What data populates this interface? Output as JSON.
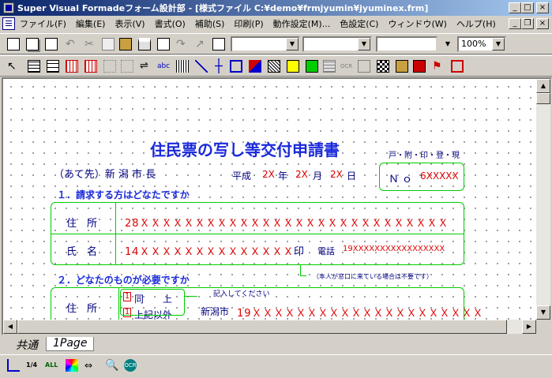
{
  "window": {
    "title": "Super Visual Formadeフォーム設計部 - [様式ファイル C:¥demo¥frmjyumin¥jyuminex.frm]",
    "minimize": "_",
    "maximize": "□",
    "close": "×"
  },
  "menu": {
    "items": [
      "ファイル(F)",
      "編集(E)",
      "表示(V)",
      "書式(O)",
      "補助(S)",
      "印刷(P)",
      "動作設定(M)...",
      "色設定(C)",
      "ウィンドウ(W)",
      "ヘルプ(H)"
    ]
  },
  "toolbar": {
    "zoom_value": "100%"
  },
  "form": {
    "title": "住民票の写し等交付申請書",
    "office_marks": "戸・附・印・登・現",
    "recipient": "（あて先）新 潟 市 長",
    "era": "平成",
    "year_value": "2X",
    "year_label": "年",
    "month_value": "2X",
    "month_label": "月",
    "day_value": "2X",
    "day_label": "日",
    "number_label": "Ｎｏ",
    "number_value": "6XXXXX",
    "section1": "１．請求する方はどなたですか",
    "address_label": "住　所",
    "address_value": "28ＸＸＸＸＸＸＸＸＸＸＸＸＸＸＸＸＸＸＸＸＸＸＸＸＸＸＸＸ",
    "name_label": "氏　名",
    "name_value": "14ＸＸＸＸＸＸＸＸＸＸＸＸＸＸ",
    "seal_label": "印",
    "phone_label": "電話",
    "phone_value": "19XXXXXXXXXXXXXXXXX",
    "note": "（本人が窓口に来ている場合は不要です）",
    "section2": "２．どなたのものが必要ですか",
    "address2_label": "住　所",
    "option1_check": "1",
    "option1": "同　　上",
    "option2_check": "1",
    "option2": "上記以外",
    "fill_hint": "記入してください",
    "city": "新潟市",
    "address2_value": "19ＸＸＸＸＸＸＸＸＸＸＸＸＸＸＸＸＸＸＸＸＸ"
  },
  "tabs": [
    "共通",
    "1Page"
  ]
}
